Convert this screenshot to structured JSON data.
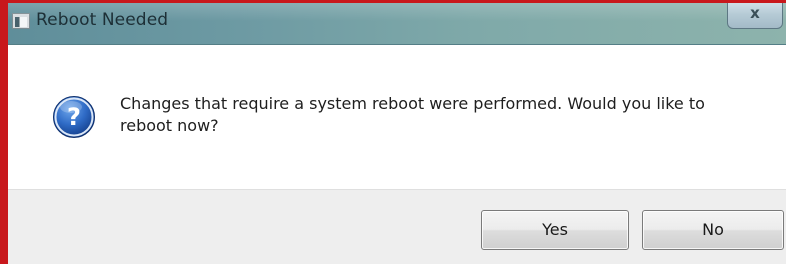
{
  "window": {
    "title": "Reboot Needed",
    "close_label": "x"
  },
  "message": {
    "text": "Changes that require a system reboot were performed. Would you like to reboot now?",
    "icon": "question-icon"
  },
  "buttons": {
    "yes_label": "Yes",
    "no_label": "No"
  },
  "colors": {
    "border_accent": "#c8181c",
    "titlebar": "#6d9aa3",
    "icon_blue": "#2a62b8"
  }
}
